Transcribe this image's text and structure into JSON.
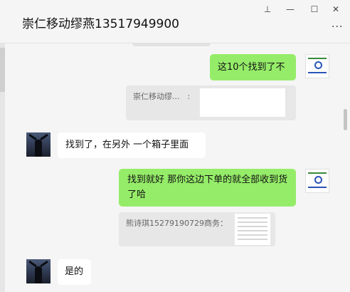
{
  "window": {
    "title": "崇仁移动缪燕13517949900",
    "pin_glyph": "⊥",
    "minimize_glyph": "—",
    "maximize_glyph": "☐",
    "close_glyph": "✕",
    "more_glyph": "···"
  },
  "messages": [
    {
      "side": "right",
      "type": "text",
      "text": "这10个找到了不"
    },
    {
      "side": "right",
      "type": "quote",
      "text": "崇仁移动缪...　:"
    },
    {
      "side": "left",
      "type": "text",
      "text": "找到了，在另外 一个箱子里面"
    },
    {
      "side": "right",
      "type": "text",
      "text": "找到就好 那你这边下单的就全部收到货了哈"
    },
    {
      "side": "right",
      "type": "quote",
      "text": "熊诗琪15279190729商务："
    },
    {
      "side": "left",
      "type": "text",
      "text": "是的"
    }
  ],
  "colors": {
    "self_bubble": "#95ec69",
    "other_bubble": "#ffffff",
    "background": "#f5f5f5",
    "quote_bg": "#e7e7e7"
  },
  "icons": {
    "self_avatar": "spreadsheet-logo-avatar",
    "contact_avatar": "silhouette-arms-raised-avatar"
  }
}
